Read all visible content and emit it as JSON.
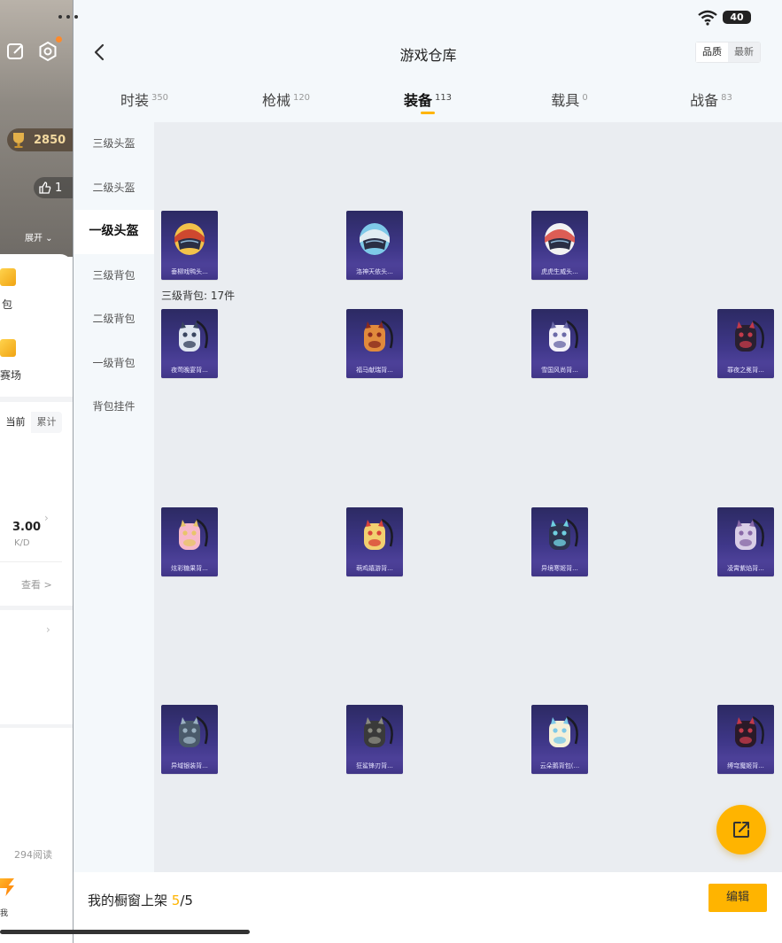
{
  "status": {
    "battery": "40"
  },
  "background_page": {
    "trophy_value": "2850",
    "likes": "1",
    "expand_label": "展开",
    "bag_label": "包",
    "arena_label": "赛场",
    "segment": {
      "current": "当前",
      "total": "累计"
    },
    "kd_value": "3.00",
    "kd_label": "K/D",
    "view_label": "查看 >",
    "reads": "294阅读",
    "bottom_label": "我"
  },
  "header": {
    "title": "游戏仓库",
    "sort": {
      "quality": "品质",
      "latest": "最新"
    }
  },
  "tabs": [
    {
      "label": "时装",
      "count": "350",
      "active": false
    },
    {
      "label": "枪械",
      "count": "120",
      "active": false
    },
    {
      "label": "装备",
      "count": "113",
      "active": true
    },
    {
      "label": "载具",
      "count": "0",
      "active": false
    },
    {
      "label": "战备",
      "count": "83",
      "active": false
    }
  ],
  "subnav": [
    {
      "label": "三级头盔",
      "active": false
    },
    {
      "label": "二级头盔",
      "active": false
    },
    {
      "label": "一级头盔",
      "active": true
    },
    {
      "label": "三级背包",
      "active": false
    },
    {
      "label": "二级背包",
      "active": false
    },
    {
      "label": "一级背包",
      "active": false
    },
    {
      "label": "背包挂件",
      "active": false
    }
  ],
  "section_label": "三级背包: 17件",
  "helmets": [
    {
      "name": "垂柳戏鸭头...",
      "icon": "helmet-icon",
      "colors": [
        "#f2c24a",
        "#c8332a"
      ]
    },
    {
      "name": "洛神天依头...",
      "icon": "helmet-icon",
      "colors": [
        "#7ec9e8",
        "#f2f2f2"
      ]
    },
    {
      "name": "虎虎生威头...",
      "icon": "helmet-icon",
      "colors": [
        "#f2f2f2",
        "#d8433a"
      ]
    }
  ],
  "backpacks": [
    {
      "name": "夜莺晚宴背...",
      "icon": "backpack-icon",
      "colors": [
        "#dfe6f0",
        "#3a4660"
      ]
    },
    {
      "name": "福马献瑞背...",
      "icon": "backpack-icon",
      "colors": [
        "#e08a3c",
        "#8a2a1e"
      ]
    },
    {
      "name": "雪国风尚背...",
      "icon": "backpack-icon",
      "colors": [
        "#f2f0f8",
        "#6c6aa8"
      ]
    },
    {
      "name": "罪夜之冕背...",
      "icon": "backpack-icon",
      "colors": [
        "#2a2030",
        "#c23a4a"
      ]
    },
    {
      "name": "炫彩糖果背...",
      "icon": "backpack-icon",
      "colors": [
        "#f7b8c9",
        "#e8c56a"
      ]
    },
    {
      "name": "萌鸡嬉游背...",
      "icon": "backpack-icon",
      "colors": [
        "#f2d070",
        "#d8433a"
      ]
    },
    {
      "name": "异境寒姬背...",
      "icon": "backpack-icon",
      "colors": [
        "#2e3450",
        "#6fd0e0"
      ]
    },
    {
      "name": "凌霄紫焰背...",
      "icon": "backpack-icon",
      "colors": [
        "#d8cde6",
        "#8a6aa8"
      ]
    },
    {
      "name": "异域银装背...",
      "icon": "backpack-icon",
      "colors": [
        "#4a5a6a",
        "#9ab0c0"
      ]
    },
    {
      "name": "狂鲨锋刃背...",
      "icon": "backpack-icon",
      "colors": [
        "#3a3a3a",
        "#8a8a80"
      ]
    },
    {
      "name": "云朵鹅背包(...",
      "icon": "backpack-icon",
      "colors": [
        "#f5f0d8",
        "#7ec9e8"
      ]
    },
    {
      "name": "缚穹魔姬背...",
      "icon": "backpack-icon",
      "colors": [
        "#2a1a28",
        "#c23a4a"
      ]
    }
  ],
  "showcase": {
    "prefix": "我的橱窗上架 ",
    "current": "5",
    "total": "/5"
  },
  "edit_label": "编辑",
  "accent_color": "#ffb400"
}
